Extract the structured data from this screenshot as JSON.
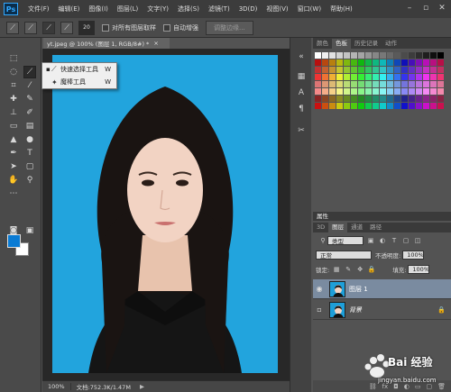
{
  "app": {
    "logo": "Ps"
  },
  "menu": [
    "文件(F)",
    "编辑(E)",
    "图像(I)",
    "图层(L)",
    "文字(Y)",
    "选择(S)",
    "滤镜(T)",
    "3D(D)",
    "视图(V)",
    "窗口(W)",
    "帮助(H)"
  ],
  "options": {
    "brush_size": "20",
    "sample_all_layers": "对所有图层取样",
    "auto_enhance": "自动增强",
    "refine_edge": "调整边缘..."
  },
  "document": {
    "tab_title": "yt.jpeg @ 100% (图层 1, RGB/8#) *",
    "close": "×",
    "zoom": "100%",
    "doc_info": "文档:752.3K/1.47M",
    "photo_bg": "#1e9fd9"
  },
  "flyout": {
    "items": [
      {
        "dot": "▪",
        "icon": "quick-selection-icon",
        "label": "快速选择工具",
        "key": "W"
      },
      {
        "dot": "",
        "icon": "magic-wand-icon",
        "label": "魔棒工具",
        "key": "W"
      }
    ]
  },
  "colors": {
    "foreground": "#0a7bd4",
    "background": "#ffffff"
  },
  "panels": {
    "swatch_tabs": [
      "颜色",
      "色板",
      "历史记录",
      "动作"
    ],
    "properties": "属性",
    "layer_tabs": [
      "3D",
      "图层",
      "通道",
      "路径"
    ],
    "kind_filter": "类型",
    "blend_mode": "正常",
    "opacity_label": "不透明度:",
    "opacity_value": "100%",
    "lock_label": "锁定:",
    "fill_label": "填充:",
    "fill_value": "100%",
    "layers": [
      {
        "name": "图层 1",
        "selected": true
      },
      {
        "name": "背景",
        "selected": false,
        "locked": true
      }
    ]
  },
  "watermark": {
    "brand": "Bai 经验",
    "url": "jingyan.baidu.com"
  }
}
